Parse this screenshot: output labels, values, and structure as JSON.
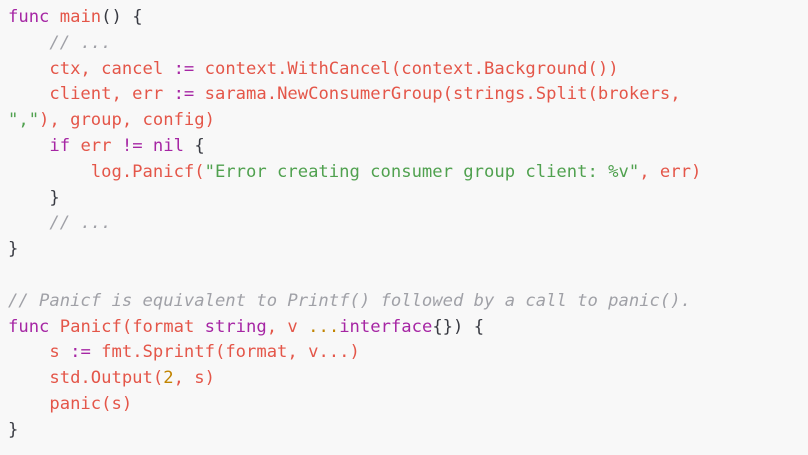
{
  "lines": [
    [
      {
        "t": "func",
        "c": "kw"
      },
      {
        "t": " ",
        "c": "pl"
      },
      {
        "t": "main",
        "c": "fn"
      },
      {
        "t": "() {",
        "c": "pl"
      }
    ],
    [
      {
        "t": "    ",
        "c": "pl"
      },
      {
        "t": "// ...",
        "c": "cm"
      }
    ],
    [
      {
        "t": "    ctx, cancel ",
        "c": "fn"
      },
      {
        "t": ":=",
        "c": "kw"
      },
      {
        "t": " context.WithCancel(context.Background())",
        "c": "fn"
      }
    ],
    [
      {
        "t": "    client, err ",
        "c": "fn"
      },
      {
        "t": ":=",
        "c": "kw"
      },
      {
        "t": " sarama.NewConsumerGroup(strings.Split(brokers,",
        "c": "fn"
      }
    ],
    [
      {
        "t": "\",\"",
        "c": "str"
      },
      {
        "t": "), group, config)",
        "c": "fn"
      }
    ],
    [
      {
        "t": "    ",
        "c": "pl"
      },
      {
        "t": "if",
        "c": "kw"
      },
      {
        "t": " err ",
        "c": "fn"
      },
      {
        "t": "!=",
        "c": "kw"
      },
      {
        "t": " ",
        "c": "pl"
      },
      {
        "t": "nil",
        "c": "kw"
      },
      {
        "t": " {",
        "c": "pl"
      }
    ],
    [
      {
        "t": "        log.Panicf(",
        "c": "fn"
      },
      {
        "t": "\"Error creating consumer group client: %v\"",
        "c": "str"
      },
      {
        "t": ", err)",
        "c": "fn"
      }
    ],
    [
      {
        "t": "    }",
        "c": "pl"
      }
    ],
    [
      {
        "t": "    ",
        "c": "pl"
      },
      {
        "t": "// ...",
        "c": "cm"
      }
    ],
    [
      {
        "t": "}",
        "c": "pl"
      }
    ],
    [
      {
        "t": "",
        "c": "pl"
      }
    ],
    [
      {
        "t": "// Panicf is equivalent to Printf() followed by a call to panic().",
        "c": "cm"
      }
    ],
    [
      {
        "t": "func",
        "c": "kw"
      },
      {
        "t": " ",
        "c": "pl"
      },
      {
        "t": "Panicf(format ",
        "c": "fn"
      },
      {
        "t": "string",
        "c": "kw"
      },
      {
        "t": ", v ",
        "c": "fn"
      },
      {
        "t": "...",
        "c": "num"
      },
      {
        "t": "interface",
        "c": "kw"
      },
      {
        "t": "{}) {",
        "c": "pl"
      }
    ],
    [
      {
        "t": "    s ",
        "c": "fn"
      },
      {
        "t": ":=",
        "c": "kw"
      },
      {
        "t": " fmt.Sprintf(format, v...)",
        "c": "fn"
      }
    ],
    [
      {
        "t": "    std.Output(",
        "c": "fn"
      },
      {
        "t": "2",
        "c": "num"
      },
      {
        "t": ", s)",
        "c": "fn"
      }
    ],
    [
      {
        "t": "    panic(s)",
        "c": "fn"
      }
    ],
    [
      {
        "t": "}",
        "c": "pl"
      }
    ]
  ]
}
